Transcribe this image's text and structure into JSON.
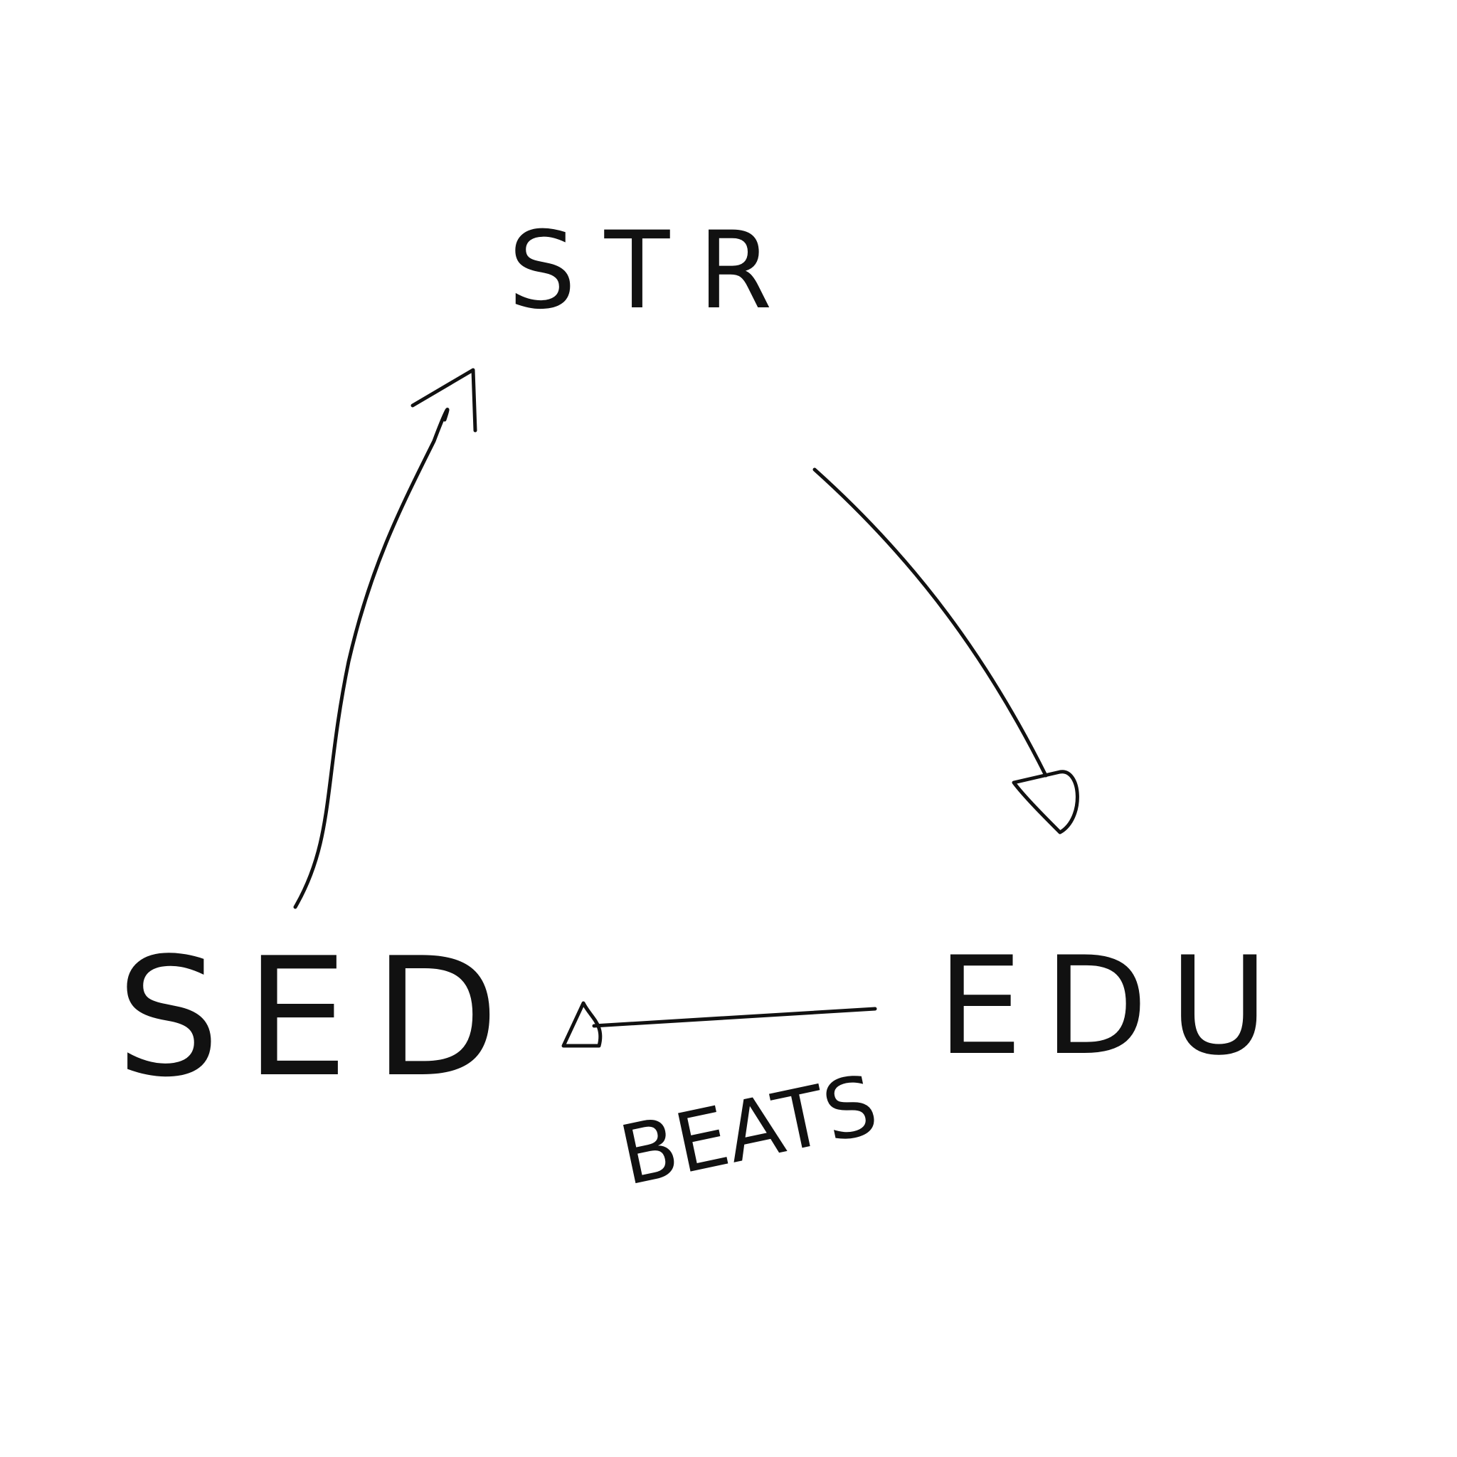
{
  "diagram": {
    "nodes": [
      {
        "id": "str",
        "label": "STR"
      },
      {
        "id": "edu",
        "label": "EDU"
      },
      {
        "id": "sed",
        "label": "SED"
      }
    ],
    "edges": [
      {
        "id": "str-to-edu",
        "from": "STR",
        "to": "EDU",
        "label": ""
      },
      {
        "id": "edu-to-sed",
        "from": "EDU",
        "to": "SED",
        "label": "BEATS"
      },
      {
        "id": "sed-to-str",
        "from": "SED",
        "to": "STR",
        "label": ""
      }
    ]
  },
  "colors": {
    "ink": "#111111",
    "background": "#ffffff"
  }
}
